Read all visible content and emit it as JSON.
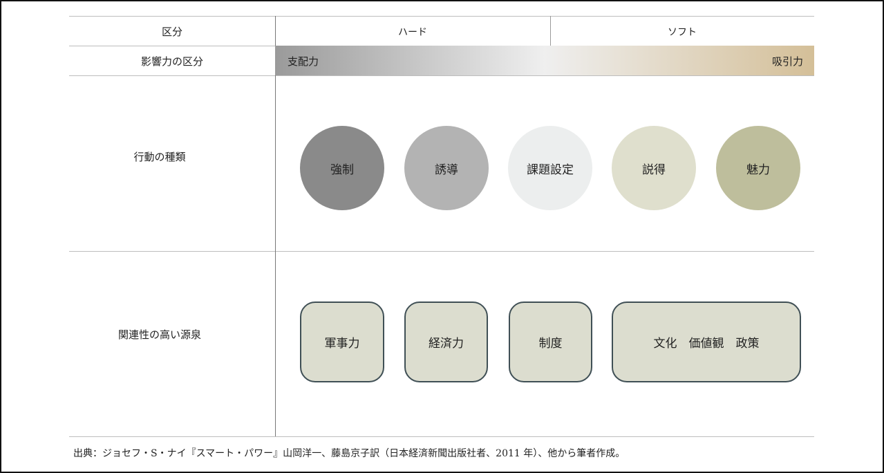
{
  "header": {
    "category_label": "区分",
    "hard_label": "ハード",
    "soft_label": "ソフト"
  },
  "influence": {
    "row_label": "影響力の区分",
    "left_label": "支配力",
    "right_label": "吸引力",
    "gradient_colors": [
      "#9a9a9a",
      "#efefef",
      "#d4bf98"
    ]
  },
  "actions": {
    "row_label": "行動の種類",
    "items": [
      {
        "label": "強制",
        "color": "#8a8a8a"
      },
      {
        "label": "誘導",
        "color": "#b3b3b3"
      },
      {
        "label": "課題設定",
        "color": "#eceeee"
      },
      {
        "label": "説得",
        "color": "#dfdfcd"
      },
      {
        "label": "魅力",
        "color": "#bebe9c"
      }
    ]
  },
  "sources": {
    "row_label": "関連性の高い源泉",
    "items": [
      {
        "label": "軍事力"
      },
      {
        "label": "経済力"
      },
      {
        "label": "制度"
      },
      {
        "label": "文化　価値観　政策"
      }
    ],
    "box_color": "#dcddcf",
    "border_color": "#3f4f55"
  },
  "footer": {
    "source_text": "出典：ジョセフ・S・ナイ『スマート・パワー』山岡洋一、藤島京子訳（日本経済新聞出版社者、2011 年）、他から筆者作成。"
  }
}
